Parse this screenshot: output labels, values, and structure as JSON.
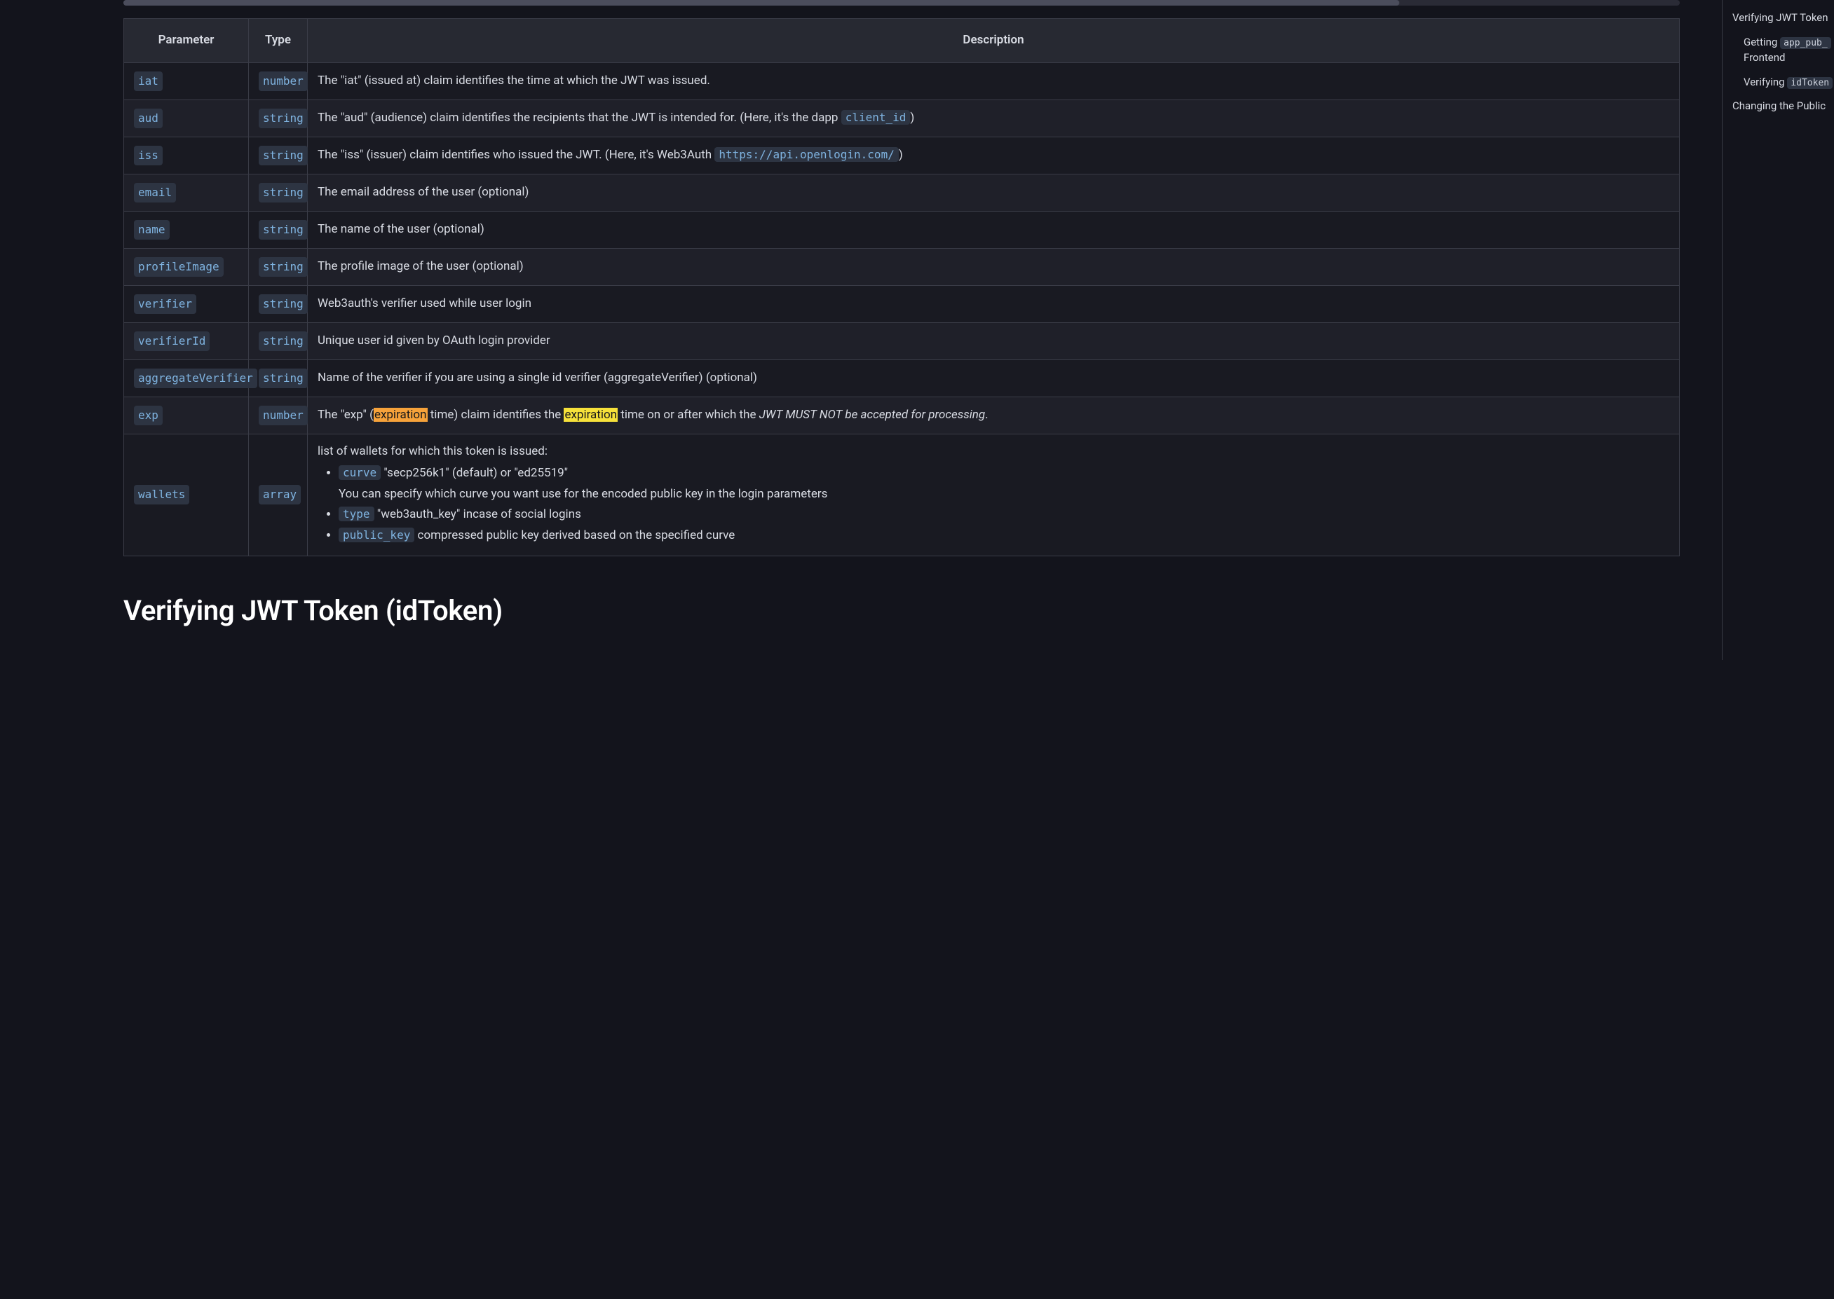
{
  "table": {
    "headers": {
      "param": "Parameter",
      "type": "Type",
      "desc": "Description"
    },
    "rows": {
      "iat": {
        "param": "iat",
        "type": "number",
        "desc": "The \"iat\" (issued at) claim identifies the time at which the JWT was issued."
      },
      "aud": {
        "param": "aud",
        "type": "string",
        "desc_pre": "The \"aud\" (audience) claim identifies the recipients that the JWT is intended for. (Here, it's the dapp ",
        "code": "client_id",
        "desc_post": ")"
      },
      "iss": {
        "param": "iss",
        "type": "string",
        "desc_pre": "The \"iss\" (issuer) claim identifies who issued the JWT. (Here, it's Web3Auth ",
        "code": "https://api.openlogin.com/",
        "desc_post": ")"
      },
      "email": {
        "param": "email",
        "type": "string",
        "desc": "The email address of the user (optional)"
      },
      "name": {
        "param": "name",
        "type": "string",
        "desc": "The name of the user (optional)"
      },
      "profileImage": {
        "param": "profileImage",
        "type": "string",
        "desc": "The profile image of the user (optional)"
      },
      "verifier": {
        "param": "verifier",
        "type": "string",
        "desc": "Web3auth's verifier used while user login"
      },
      "verifierId": {
        "param": "verifierId",
        "type": "string",
        "desc": "Unique user id given by OAuth login provider"
      },
      "aggregateVerifier": {
        "param": "aggregateVerifier",
        "type": "string",
        "desc": "Name of the verifier if you are using a single id verifier (aggregateVerifier) (optional)"
      },
      "exp": {
        "param": "exp",
        "type": "number",
        "p1": "The \"exp\" (",
        "h1": "expiration",
        "p2": " time) claim identifies the ",
        "h2": "expiration",
        "p3": " time on or after which the ",
        "em": "JWT MUST NOT be accepted for processing",
        "p4": "."
      },
      "wallets": {
        "param": "wallets",
        "type": "array",
        "lead": "list of wallets for which this token is issued:",
        "items": {
          "curve": {
            "code": "curve",
            "text": " \"secp256k1\" (default) or \"ed25519\"",
            "sub": "You can specify which curve you want use for the encoded public key in the login parameters"
          },
          "type": {
            "code": "type",
            "text": " \"web3auth_key\" incase of social logins"
          },
          "public_key": {
            "code": "public_key",
            "text": " compressed public key derived based on the specified curve"
          }
        }
      }
    }
  },
  "heading": "Verifying JWT Token (idToken)",
  "rightnav": {
    "l1": "Verifying JWT Token",
    "l2_pre": "Getting ",
    "l2_code": "app_pub_",
    "l2_post": "Frontend",
    "l3_pre": "Verifying ",
    "l3_code": "idToken",
    "l4": "Changing the Public"
  }
}
